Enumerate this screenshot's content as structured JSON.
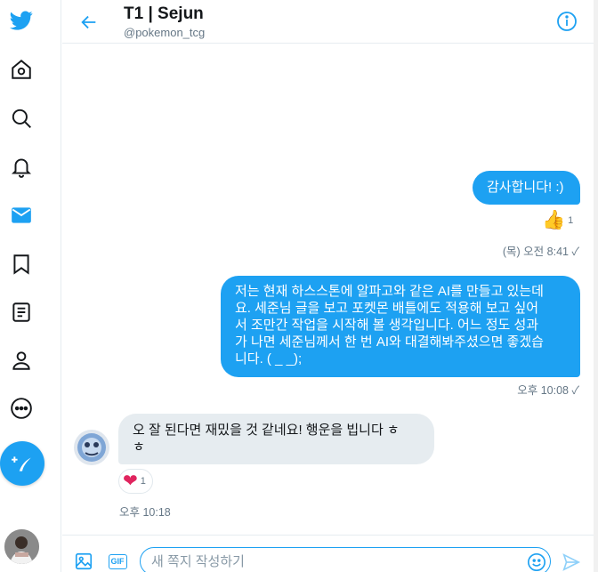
{
  "colors": {
    "accent": "#1da1f2",
    "incoming_bubble": "#e6ecf0",
    "muted_text": "#657786",
    "heart": "#e0245e"
  },
  "nav": {
    "items": [
      {
        "name": "twitter-logo-icon"
      },
      {
        "name": "home-icon"
      },
      {
        "name": "explore-icon"
      },
      {
        "name": "notifications-icon"
      },
      {
        "name": "messages-icon"
      },
      {
        "name": "bookmarks-icon"
      },
      {
        "name": "lists-icon"
      },
      {
        "name": "profile-icon"
      },
      {
        "name": "more-icon"
      }
    ],
    "compose_icon": "feather-plus-icon"
  },
  "header": {
    "title": "T1 | Sejun",
    "handle": "@pokemon_tcg",
    "back_icon": "back-arrow-icon",
    "info_icon": "info-icon"
  },
  "messages": [
    {
      "direction": "out",
      "text": "감사합니다! :)",
      "reaction": {
        "emoji": "👍",
        "count": "1"
      },
      "time": "(목) 오전 8:41 ✓"
    },
    {
      "direction": "out",
      "lines": [
        "저는 현재 하스스톤에 알파고와 같은 AI를 만들고 있는데",
        "요. 세준님 글을 보고 포켓몬 배틀에도 적용해 보고 싶어",
        "서 조만간 작업을 시작해 볼 생각입니다. 어느 정도 성과",
        "가 나면 세준님께서 한 번 AI와 대결해봐주셨으면 좋겠습",
        "니다. ( _ _);"
      ],
      "time": "오후 10:08 ✓"
    },
    {
      "direction": "in",
      "lines": [
        "오 잘 된다면 재밌을 것 같네요! 행운을 빕니다 ㅎ",
        "ㅎ"
      ],
      "reaction": {
        "emoji": "❤",
        "count": "1"
      },
      "time": "오후 10:18"
    }
  ],
  "composer": {
    "placeholder": "새 쪽지 작성하기",
    "value": "",
    "media_icon": "image-icon",
    "gif_label": "GIF",
    "emoji_icon": "emoji-icon",
    "send_icon": "send-icon"
  }
}
